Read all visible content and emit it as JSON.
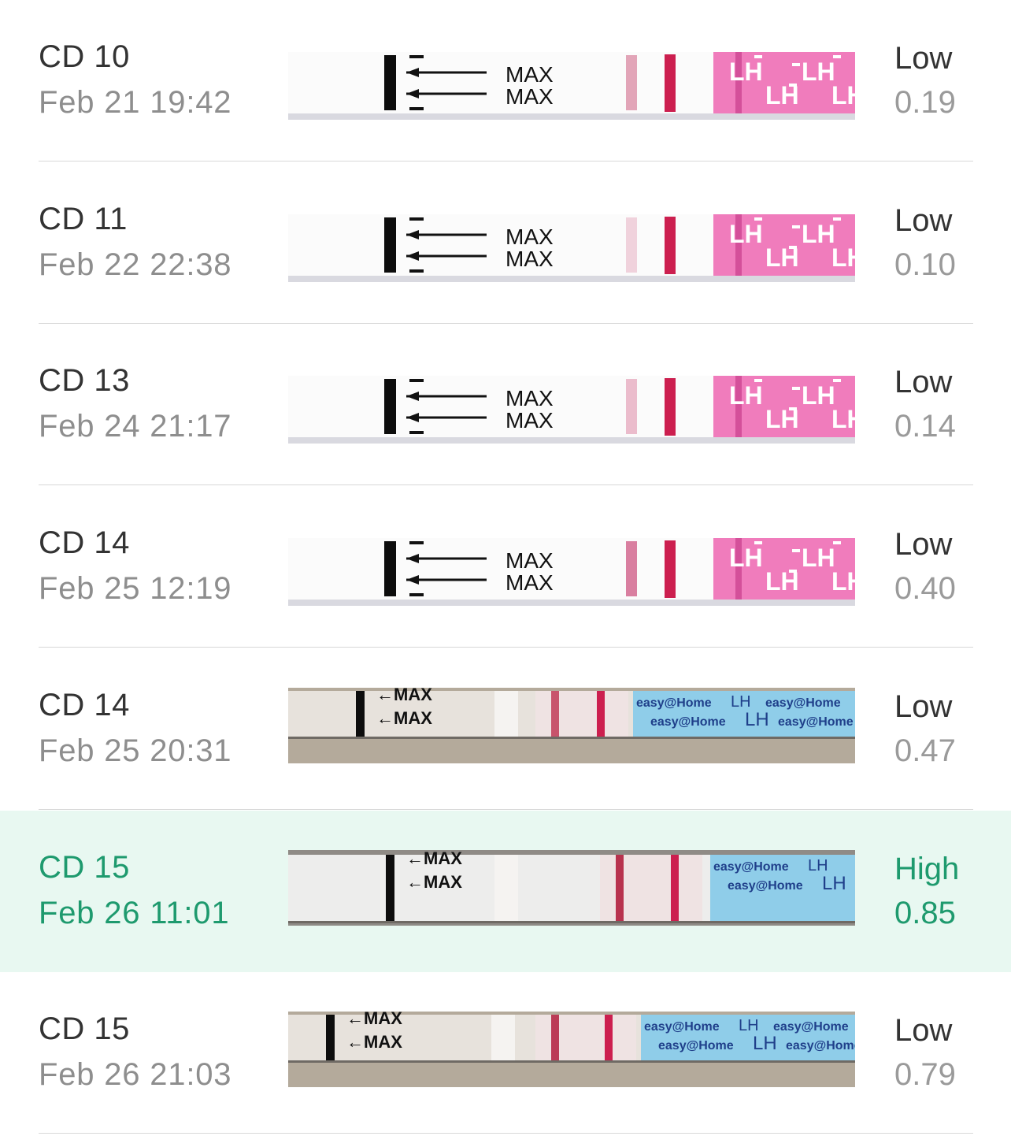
{
  "entries": [
    {
      "cd": "CD 10",
      "date": "Feb 21 19:42",
      "result": "Low",
      "value": "0.19",
      "strip_style": "pink",
      "highlight": false,
      "test_line_color": "#e2a5b8"
    },
    {
      "cd": "CD 11",
      "date": "Feb 22 22:38",
      "result": "Low",
      "value": "0.10",
      "strip_style": "pink",
      "highlight": false,
      "test_line_color": "#f0d2dc"
    },
    {
      "cd": "CD 13",
      "date": "Feb 24 21:17",
      "result": "Low",
      "value": "0.14",
      "strip_style": "pink",
      "highlight": false,
      "test_line_color": "#ebbccc"
    },
    {
      "cd": "CD 14",
      "date": "Feb 25 12:19",
      "result": "Low",
      "value": "0.40",
      "strip_style": "pink",
      "highlight": false,
      "test_line_color": "#d97fa0"
    },
    {
      "cd": "CD 14",
      "date": "Feb 25 20:31",
      "result": "Low",
      "value": "0.47",
      "strip_style": "blue",
      "highlight": false,
      "test_line_color": "#c8546c"
    },
    {
      "cd": "CD 15",
      "date": "Feb 26 11:01",
      "result": "High",
      "value": "0.85",
      "strip_style": "blue",
      "highlight": true,
      "test_line_color": "#b8324e"
    },
    {
      "cd": "CD 15",
      "date": "Feb 26 21:03",
      "result": "Low",
      "value": "0.79",
      "strip_style": "blue",
      "highlight": false,
      "test_line_color": "#bb3b56"
    }
  ],
  "strip_text": {
    "max_label": "MAX",
    "pink_brand": "LH",
    "blue_brand": "easy@Home",
    "blue_lh": "LH"
  },
  "colors": {
    "control_line": "#cc1f4f",
    "pink_band": "#f07cbc",
    "blue_band": "#8fcde9",
    "highlight_bg": "#e8f8f1",
    "highlight_text": "#1e9a6e"
  }
}
